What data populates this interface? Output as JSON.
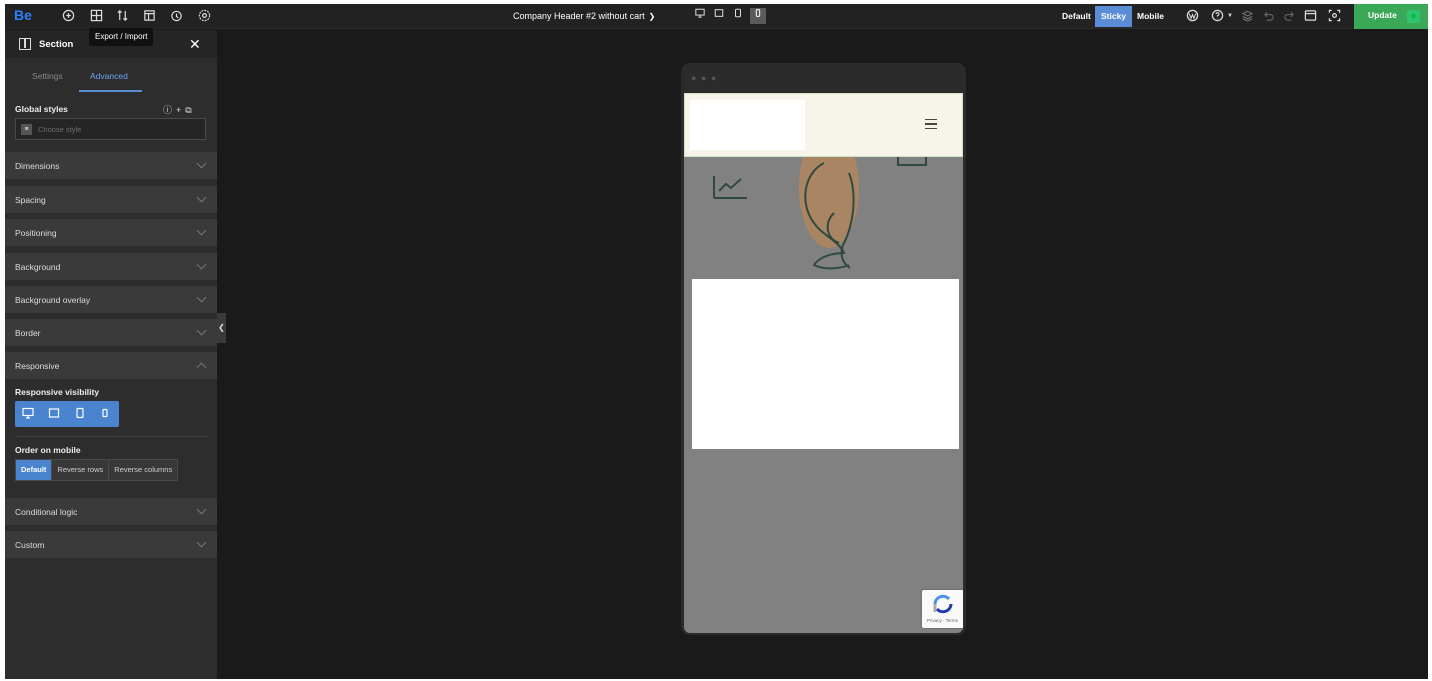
{
  "app": {
    "logo": "Be",
    "document_title": "Company Header #2 without cart",
    "tooltip": "Export / Import",
    "modes": [
      "Default",
      "Sticky",
      "Mobile"
    ],
    "active_mode": "Sticky",
    "update_label": "Update"
  },
  "sidebar": {
    "title": "Section",
    "tabs": [
      "Settings",
      "Advanced"
    ],
    "active_tab": "Advanced",
    "global_styles": {
      "label": "Global styles",
      "placeholder": "Choose style"
    },
    "sections": {
      "dimensions": "Dimensions",
      "spacing": "Spacing",
      "positioning": "Positioning",
      "background": "Background",
      "background_overlay": "Background overlay",
      "border": "Border",
      "responsive": "Responsive",
      "conditional_logic": "Conditional logic",
      "custom": "Custom"
    },
    "responsive": {
      "visibility_label": "Responsive visibility",
      "order_label": "Order on mobile",
      "order_options": [
        "Default",
        "Reverse rows",
        "Reverse columns"
      ],
      "order_selected": "Default"
    }
  },
  "preview": {
    "recaptcha_text": "Privacy - Terms"
  },
  "colors": {
    "accent": "#4a84cf",
    "update": "#3aa857",
    "header_bg": "#f7f4ea"
  }
}
